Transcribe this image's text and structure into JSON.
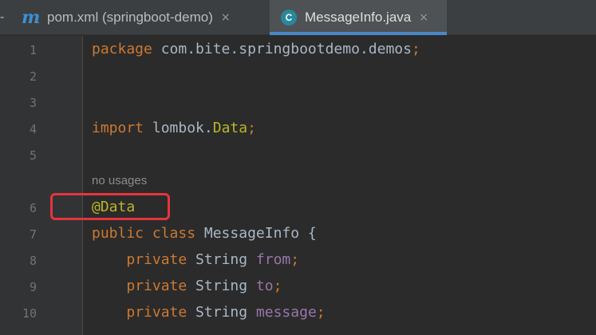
{
  "tabs": [
    {
      "icon": "m",
      "label": "pom.xml (springboot-demo)",
      "close": "×"
    },
    {
      "icon": "C",
      "label": "MessageInfo.java",
      "close": "×"
    }
  ],
  "tab_overflow": "-",
  "line_numbers": [
    "1",
    "2",
    "3",
    "4",
    "5",
    "6",
    "7",
    "8",
    "9",
    "10"
  ],
  "code": {
    "line1": {
      "kw": "package",
      "text": " com.bite.springbootdemo.demos",
      "end": ";"
    },
    "line4": {
      "kw": "import",
      "text": " lombok.",
      "ann": "Data",
      "end": ";"
    },
    "hint": "no usages",
    "line6": {
      "ann": "@Data"
    },
    "line7": {
      "kw": "public class",
      "text": " MessageInfo {"
    },
    "fields": [
      {
        "kw": "private",
        "type": " String ",
        "name": "from",
        "end": ";"
      },
      {
        "kw": "private",
        "type": " String ",
        "name": "to",
        "end": ";"
      },
      {
        "kw": "private",
        "type": " String ",
        "name": "message",
        "end": ";"
      }
    ]
  },
  "colors": {
    "keyword": "#cc7832",
    "field": "#9876aa",
    "annotation": "#bbb529",
    "highlight": "#e6343d",
    "active_tab_underline": "#4a88c7"
  }
}
